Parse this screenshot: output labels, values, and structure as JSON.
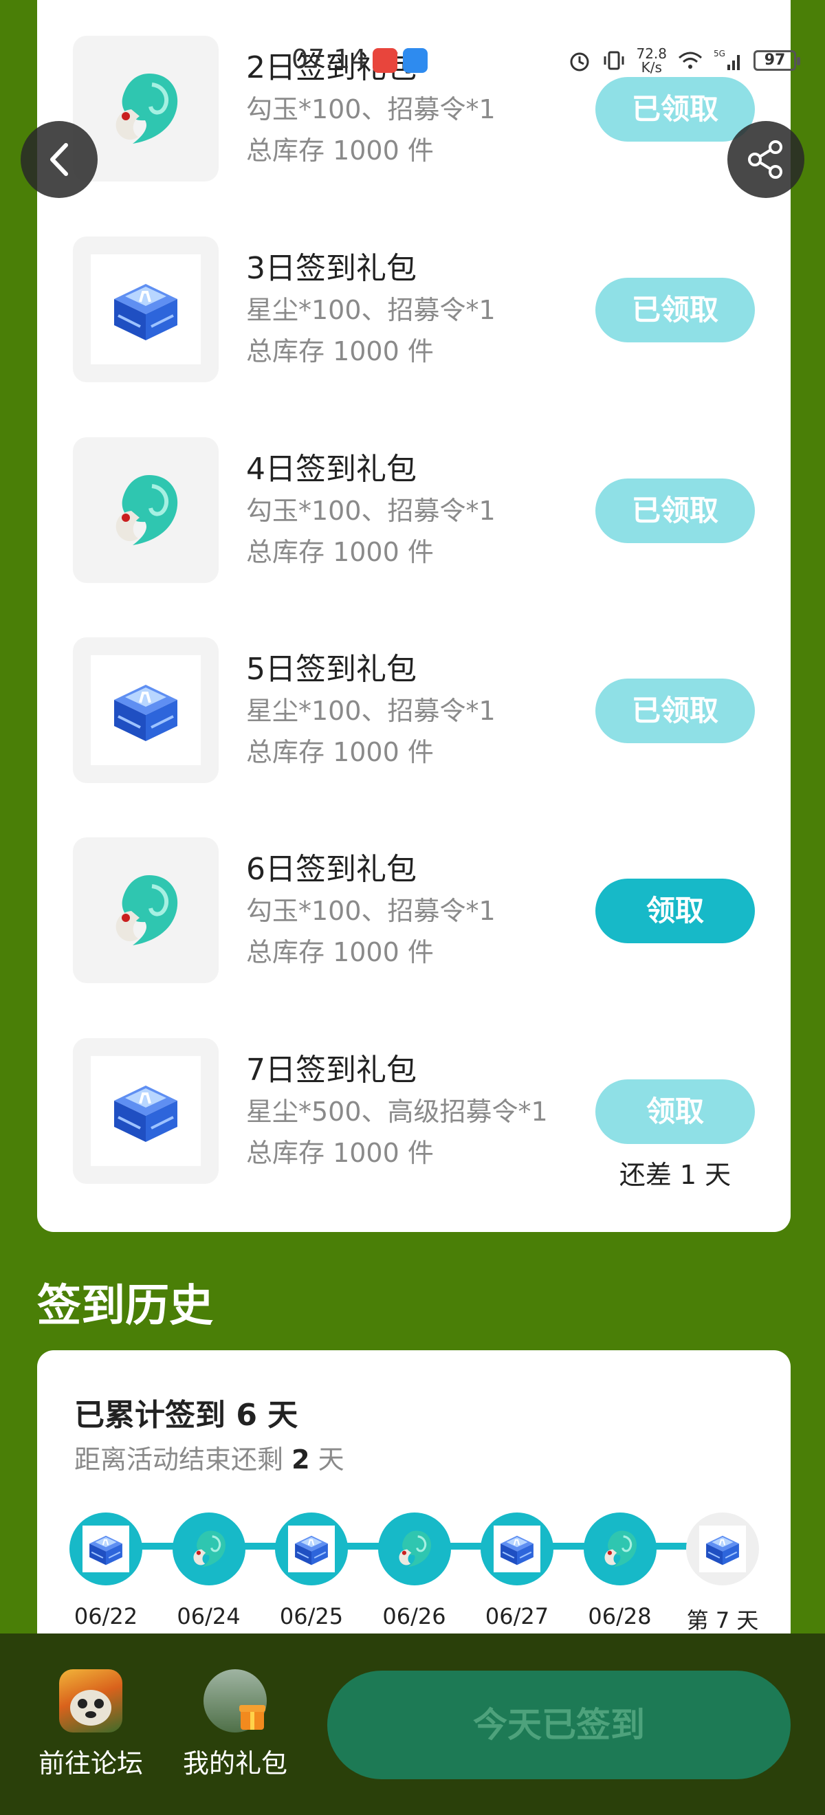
{
  "status_bar": {
    "time": "07:14",
    "speed_value": "72.8",
    "speed_unit": "K/s",
    "battery": "97"
  },
  "gifts": [
    {
      "title": "2日签到礼包",
      "desc": "勾玉*100、招募令*1",
      "stock": "总库存 1000 件",
      "button": "已领取",
      "state": "claimed",
      "icon": "magatama-icon"
    },
    {
      "title": "3日签到礼包",
      "desc": "星尘*100、招募令*1",
      "stock": "总库存 1000 件",
      "button": "已领取",
      "state": "claimed",
      "icon": "treasure-chest-icon"
    },
    {
      "title": "4日签到礼包",
      "desc": "勾玉*100、招募令*1",
      "stock": "总库存 1000 件",
      "button": "已领取",
      "state": "claimed",
      "icon": "magatama-icon"
    },
    {
      "title": "5日签到礼包",
      "desc": "星尘*100、招募令*1",
      "stock": "总库存 1000 件",
      "button": "已领取",
      "state": "claimed",
      "icon": "treasure-chest-icon"
    },
    {
      "title": "6日签到礼包",
      "desc": "勾玉*100、招募令*1",
      "stock": "总库存 1000 件",
      "button": "领取",
      "state": "active",
      "icon": "magatama-icon"
    },
    {
      "title": "7日签到礼包",
      "desc": "星尘*500、高级招募令*1",
      "stock": "总库存 1000 件",
      "button": "领取",
      "state": "disabled",
      "note": "还差 1 天",
      "icon": "treasure-chest-icon"
    }
  ],
  "history": {
    "title": "签到历史",
    "summary": "已累计签到 6 天",
    "remaining_prefix": "距离活动结束还剩 ",
    "remaining_days": "2",
    "remaining_suffix": " 天",
    "days": [
      {
        "label": "06/22",
        "icon": "treasure-chest-icon",
        "done": true
      },
      {
        "label": "06/24",
        "icon": "magatama-icon",
        "done": true
      },
      {
        "label": "06/25",
        "icon": "treasure-chest-icon",
        "done": true
      },
      {
        "label": "06/26",
        "icon": "magatama-icon",
        "done": true
      },
      {
        "label": "06/27",
        "icon": "treasure-chest-icon",
        "done": true
      },
      {
        "label": "06/28",
        "icon": "magatama-icon",
        "done": true
      },
      {
        "label": "第 7 天",
        "icon": "treasure-chest-icon",
        "done": false
      }
    ]
  },
  "bottom_nav": {
    "forum": "前往论坛",
    "gifts": "我的礼包",
    "checkin": "今天已签到"
  },
  "colors": {
    "background": "#4a7f07",
    "accent": "#17b9c8",
    "claimed": "#8fe0e6",
    "checkin_button": "#1d7a55"
  }
}
